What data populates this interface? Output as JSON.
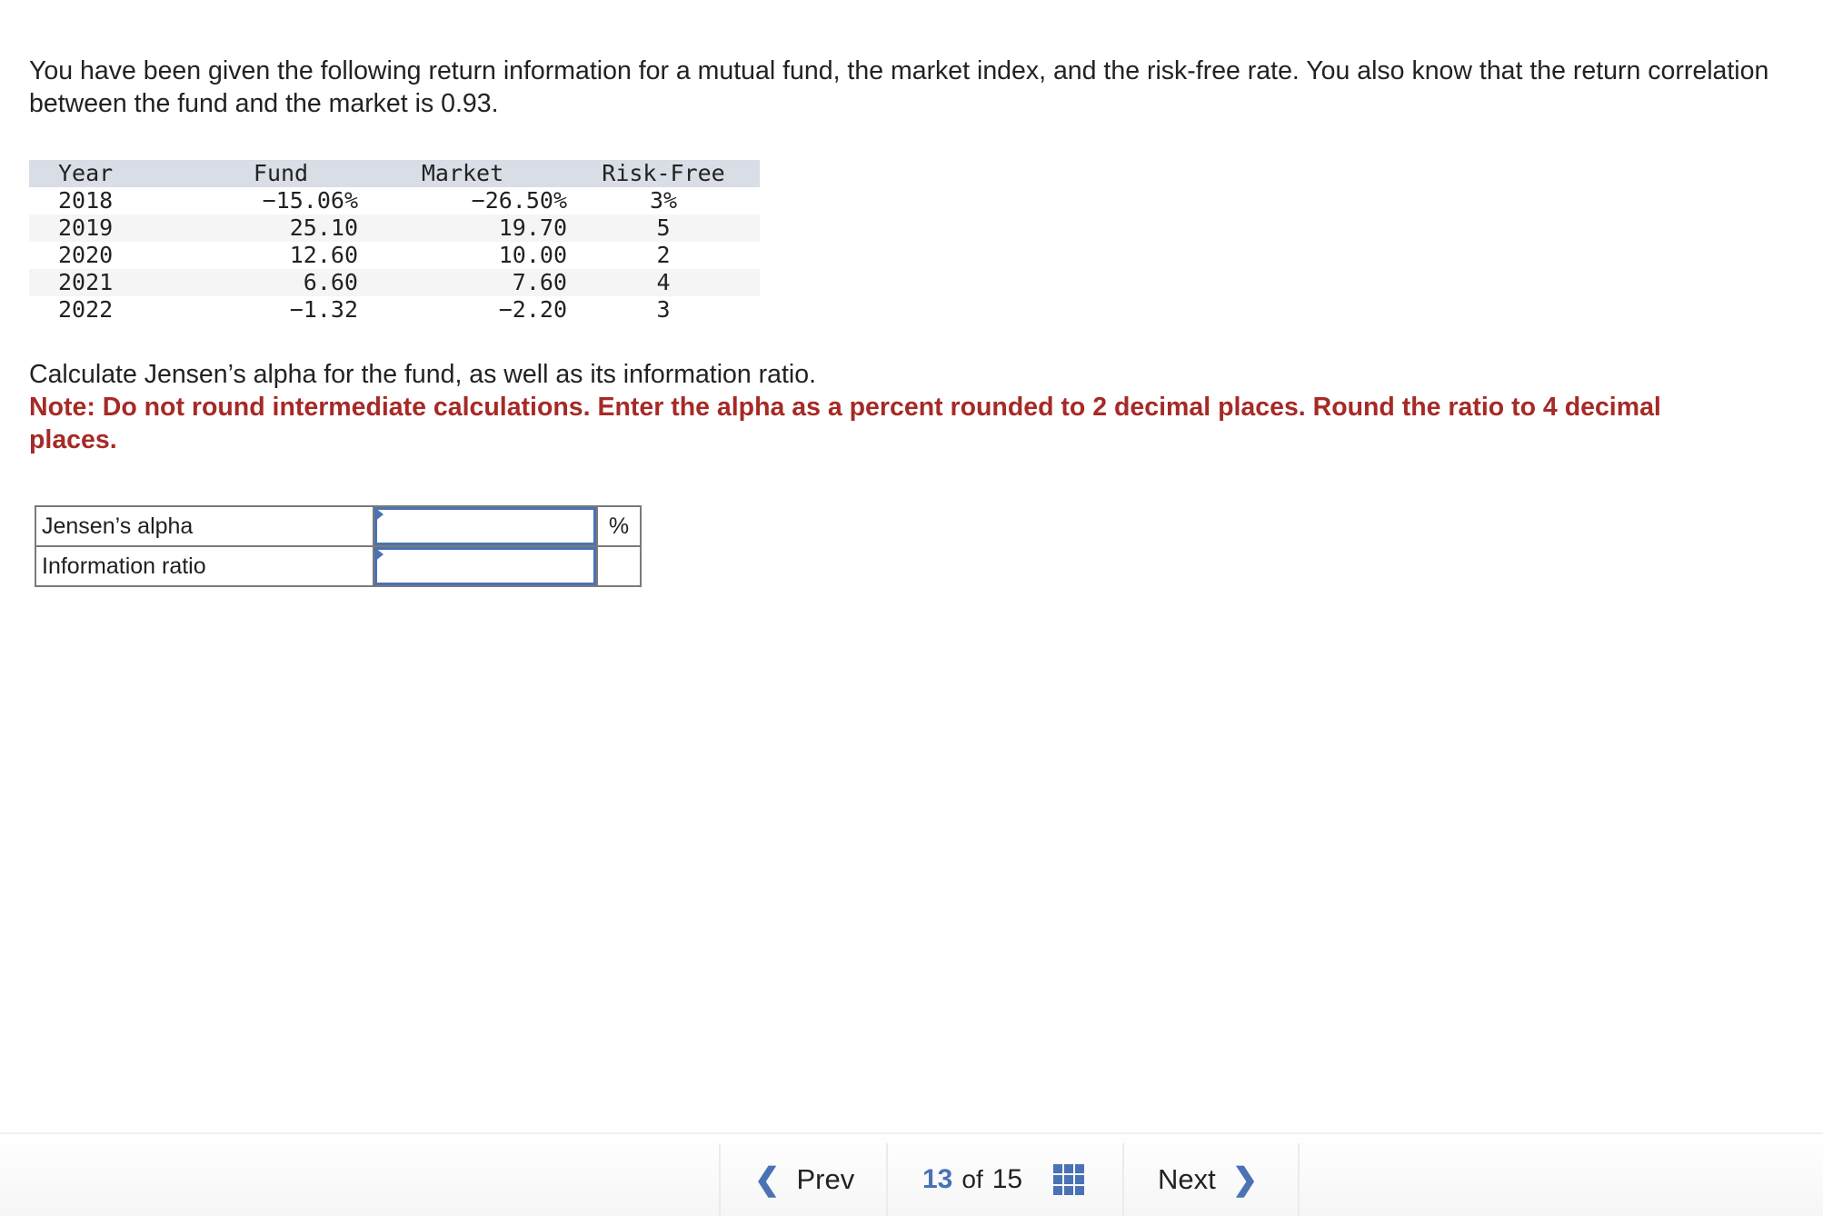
{
  "intro": "You have been given the following return information for a mutual fund, the market index, and the risk-free rate. You also know that the return correlation between the fund and the market is 0.93.",
  "returns_table": {
    "headers": [
      "Year",
      "Fund",
      "Market",
      "Risk-Free"
    ],
    "rows": [
      {
        "year": "2018",
        "fund": "−15.06%",
        "market": "−26.50%",
        "risk_free": "3%"
      },
      {
        "year": "2019",
        "fund": "25.10",
        "market": "19.70",
        "risk_free": "5"
      },
      {
        "year": "2020",
        "fund": "12.60",
        "market": "10.00",
        "risk_free": "2"
      },
      {
        "year": "2021",
        "fund": "6.60",
        "market": "7.60",
        "risk_free": "4"
      },
      {
        "year": "2022",
        "fund": "−1.32",
        "market": "−2.20",
        "risk_free": "3"
      }
    ]
  },
  "question": "Calculate Jensen’s alpha for the fund, as well as its information ratio.",
  "note": "Note: Do not round intermediate calculations. Enter the alpha as a percent rounded to 2 decimal places. Round the ratio to 4 decimal places.",
  "answers": [
    {
      "label": "Jensen’s alpha",
      "value": "",
      "unit": "%"
    },
    {
      "label": "Information ratio",
      "value": "",
      "unit": ""
    }
  ],
  "navigation": {
    "prev_label": "Prev",
    "next_label": "Next",
    "current_page": "13",
    "of_label": "of",
    "total_pages": "15",
    "prev_icon": "chevron-left-icon",
    "next_icon": "chevron-right-icon",
    "grid_icon": "question-grid-icon"
  },
  "colors": {
    "accent": "#4a72b5",
    "note_red": "#a62a26",
    "table_header_bg": "#d9dde5"
  }
}
